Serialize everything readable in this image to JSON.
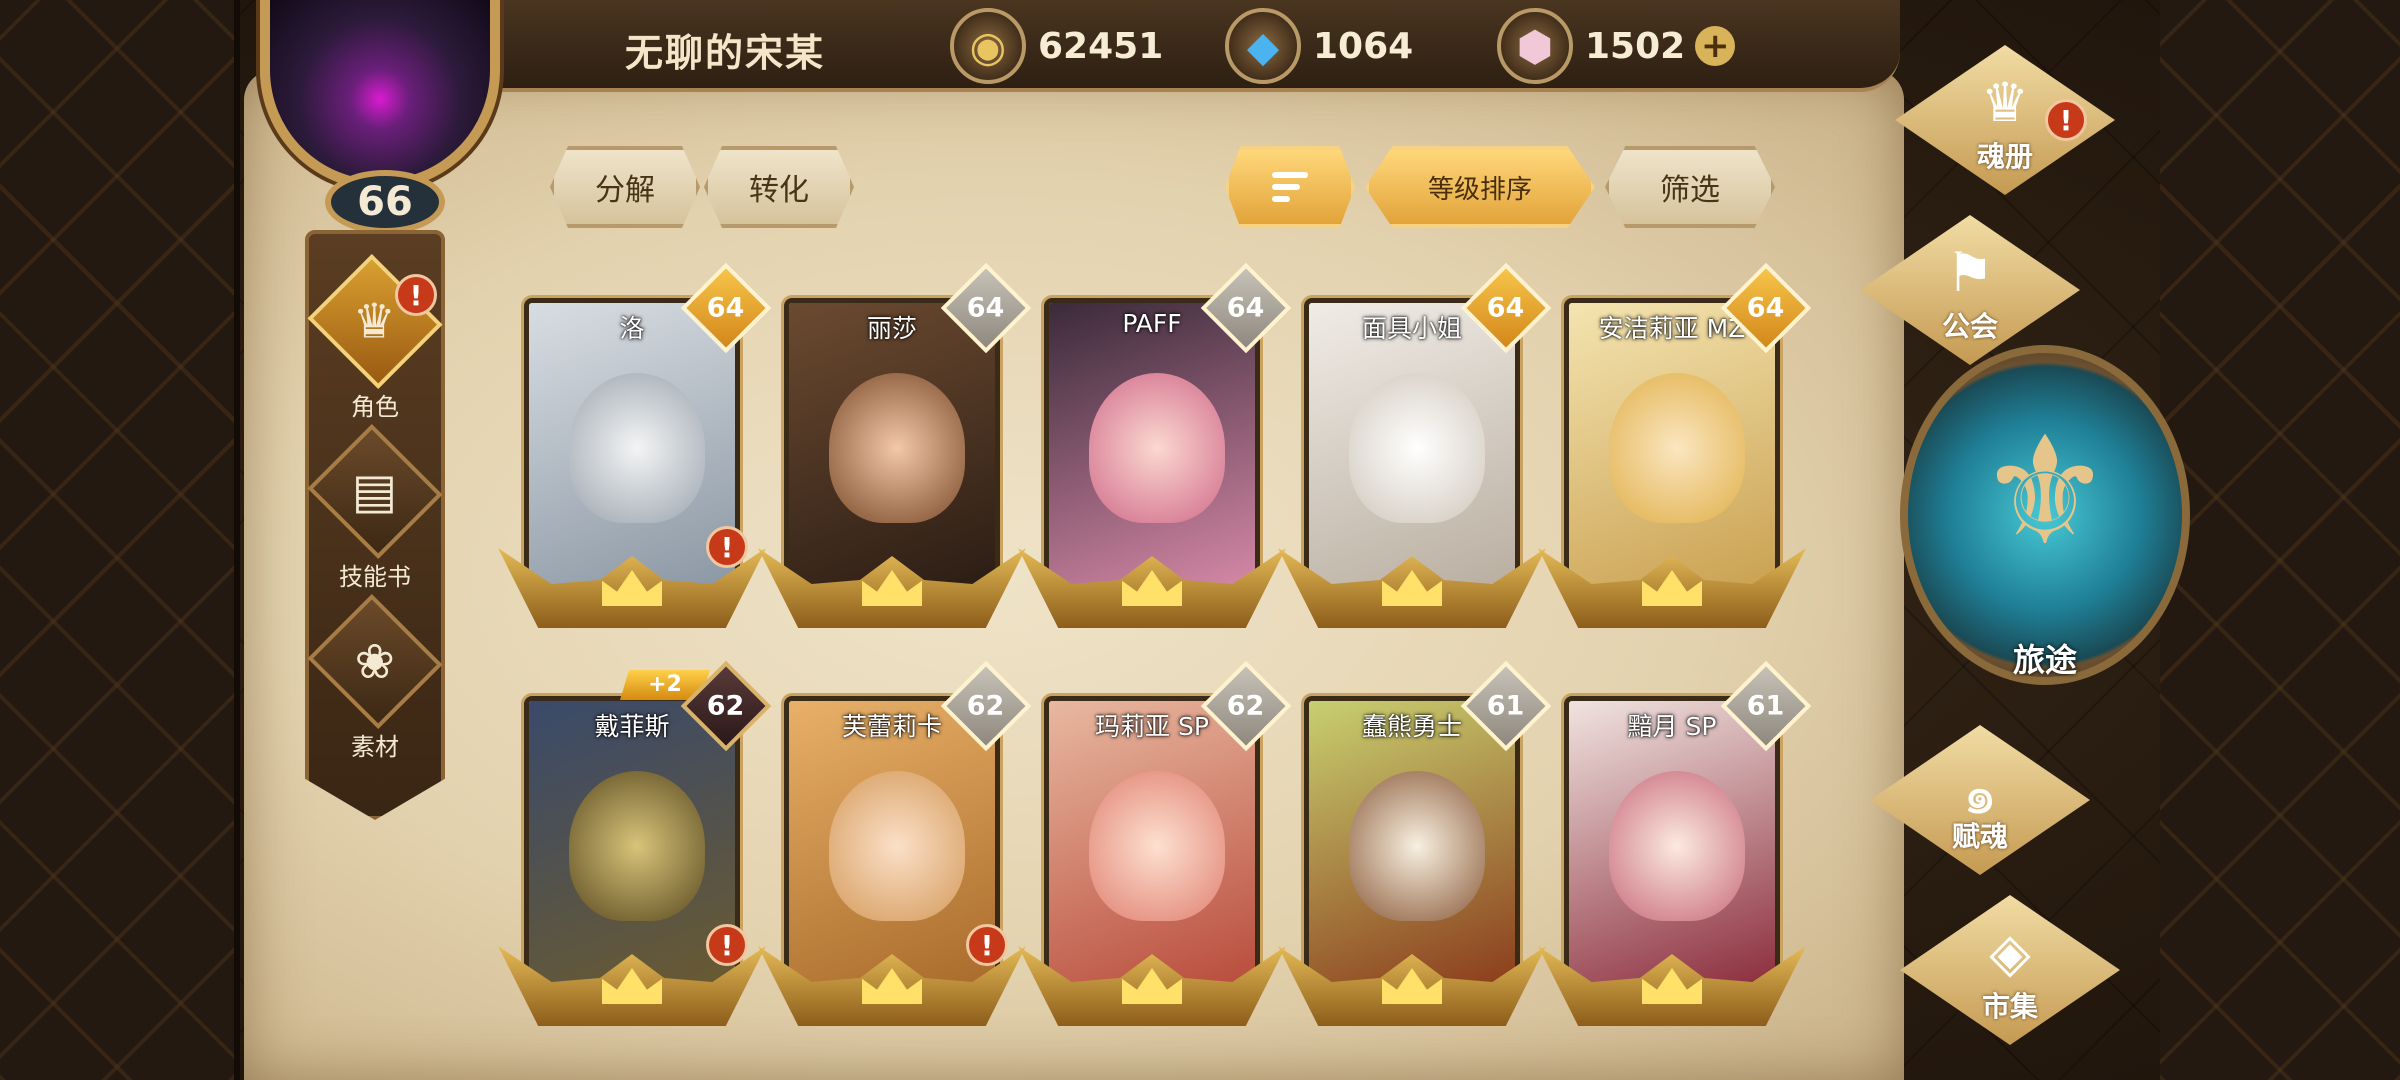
{
  "player": {
    "name": "无聊的宋某",
    "level": "66"
  },
  "currencies": [
    {
      "icon": "gold-coin-icon",
      "value": "62451"
    },
    {
      "icon": "blue-crystal-icon",
      "value": "1064"
    },
    {
      "icon": "pink-gem-icon",
      "value": "1502"
    }
  ],
  "toolbar": {
    "decompose": "分解",
    "convert": "转化",
    "sort_by_level": "等级排序",
    "filter": "筛选"
  },
  "left_nav": [
    {
      "label": "角色",
      "icon": "character-icon",
      "active": true,
      "alert": true
    },
    {
      "label": "技能书",
      "icon": "skill-book-icon",
      "active": false,
      "alert": false
    },
    {
      "label": "素材",
      "icon": "material-icon",
      "active": false,
      "alert": false
    }
  ],
  "right_nav": {
    "soul_book": "魂册",
    "guild": "公会",
    "journey": "旅途",
    "soul_bestow": "赋魂",
    "market": "市集"
  },
  "cards": [
    {
      "name": "洛",
      "level": "64",
      "alert": true,
      "plus": ""
    },
    {
      "name": "丽莎",
      "level": "64",
      "alert": false,
      "plus": ""
    },
    {
      "name": "PAFF",
      "level": "64",
      "alert": false,
      "plus": ""
    },
    {
      "name": "面具小姐",
      "level": "64",
      "alert": false,
      "plus": ""
    },
    {
      "name": "安洁莉亚 MZ",
      "level": "64",
      "alert": false,
      "plus": ""
    },
    {
      "name": "戴菲斯",
      "level": "62",
      "alert": true,
      "plus": "+2"
    },
    {
      "name": "芙蕾莉卡",
      "level": "62",
      "alert": true,
      "plus": ""
    },
    {
      "name": "玛莉亚 SP",
      "level": "62",
      "alert": false,
      "plus": ""
    },
    {
      "name": "蠢熊勇士",
      "level": "61",
      "alert": false,
      "plus": ""
    },
    {
      "name": "黯月 SP",
      "level": "61",
      "alert": false,
      "plus": ""
    }
  ],
  "alert_symbol": "!",
  "plus_symbol": "+",
  "colors": {
    "parchment": "#e3d2ae",
    "gold_accent": "#e2a43a",
    "alert_red": "#c63a1a",
    "journey_teal": "#1f7f96"
  }
}
